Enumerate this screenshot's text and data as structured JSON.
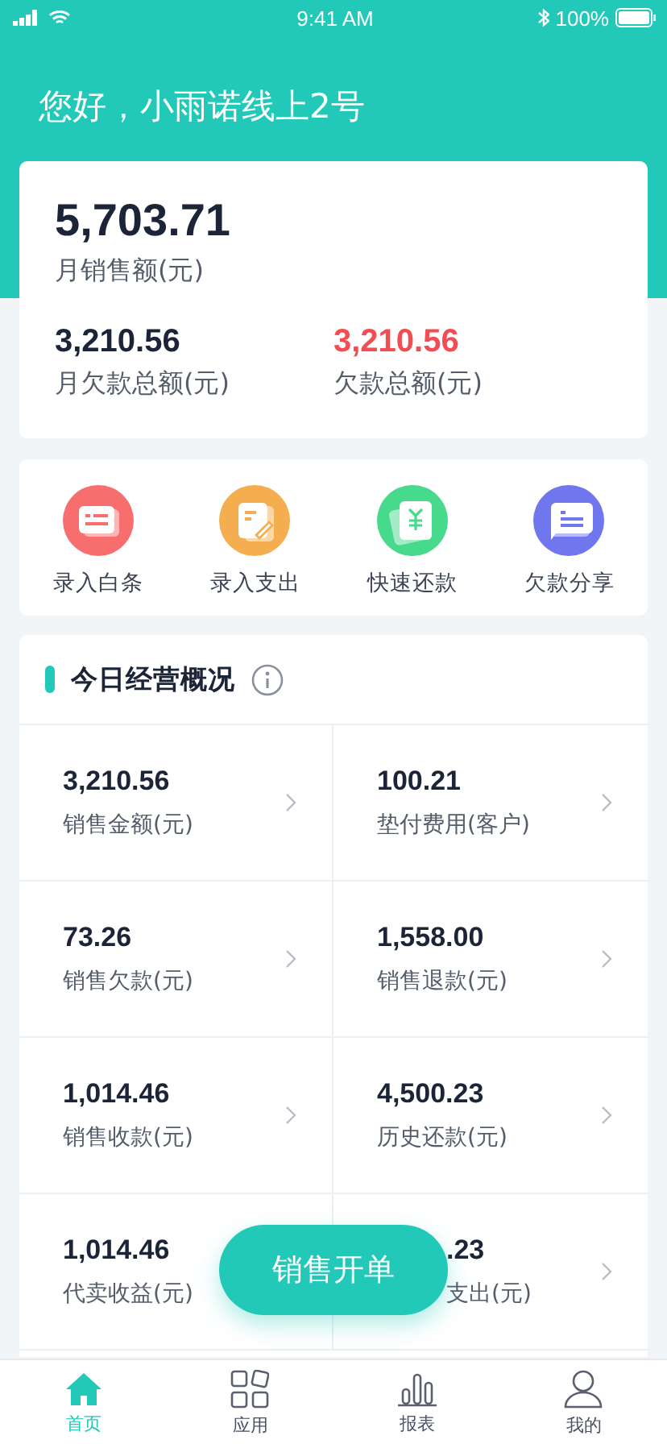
{
  "status_bar": {
    "time": "9:41 AM",
    "battery": "100%"
  },
  "header": {
    "greeting": "您好，小雨诺线上2号"
  },
  "summary": {
    "main": {
      "value": "5,703.71",
      "label": "月销售额(元)"
    },
    "items": [
      {
        "value": "3,210.56",
        "label": "月欠款总额(元)",
        "alert": false
      },
      {
        "value": "3,210.56",
        "label": "欠款总额(元)",
        "alert": true
      }
    ]
  },
  "quick_actions": [
    {
      "label": "录入白条",
      "color": "#f86d6d"
    },
    {
      "label": "录入支出",
      "color": "#f4ae4f"
    },
    {
      "label": "快速还款",
      "color": "#47d98c"
    },
    {
      "label": "欠款分享",
      "color": "#7077ee"
    }
  ],
  "overview": {
    "title": "今日经营概况",
    "cells": [
      {
        "value": "3,210.56",
        "label": "销售金额(元)",
        "kind": "full"
      },
      {
        "value": "100.21",
        "label": "垫付费用(客户)",
        "kind": "full"
      },
      {
        "value": "73.26",
        "label": "销售欠款(元)",
        "kind": "full"
      },
      {
        "value": "1,558.00",
        "label": "销售退款(元)",
        "kind": "full"
      },
      {
        "value": "1,014.46",
        "label": "销售收款(元)",
        "kind": "full"
      },
      {
        "value": "4,500.23",
        "label": "历史还款(元)",
        "kind": "full"
      },
      {
        "value": "1,014.46",
        "label": "代卖收益(元)",
        "kind": "nochevron"
      },
      {
        "value": ".23",
        "label": "支出(元)",
        "kind": "covered"
      }
    ]
  },
  "fab": {
    "label": "销售开单"
  },
  "tabs": [
    {
      "label": "首页",
      "selected": true
    },
    {
      "label": "应用",
      "selected": false
    },
    {
      "label": "报表",
      "selected": false
    },
    {
      "label": "我的",
      "selected": false
    }
  ]
}
